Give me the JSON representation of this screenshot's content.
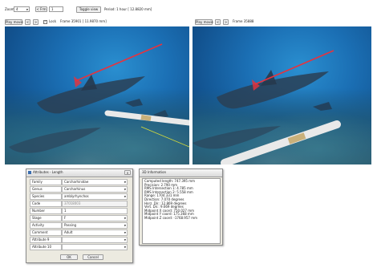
{
  "toolbar": {
    "zoom_label": "Zoom",
    "zoom_value": "4",
    "frame_step_label": "< Frm",
    "frame_step_value": "1",
    "toggle_button": "Toggle view",
    "period_text": "Period: 1 hour  [ 12.8820 mm]"
  },
  "left_pane": {
    "play_button": "Play movie",
    "nav_prev": "<",
    "nav_next": ">",
    "lock_label": "Lock",
    "frame_label": "Frame 35901  [ 11.9870 mm]"
  },
  "right_pane": {
    "play_button": "Play movie",
    "nav_prev": "<",
    "nav_next": ">",
    "frame_label": "Frame 35888"
  },
  "attributes_dialog": {
    "title": "Attributes - Length",
    "close": "×",
    "rows": [
      {
        "label": "Family",
        "value": "Carcharhinidae",
        "dropdown": true,
        "disabled": false
      },
      {
        "label": "Genus",
        "value": "Carcharhinus",
        "dropdown": true,
        "disabled": false
      },
      {
        "label": "Species",
        "value": "amblyrhynchos",
        "dropdown": true,
        "disabled": false
      },
      {
        "label": "Code",
        "value": "37018003",
        "dropdown": false,
        "disabled": true
      },
      {
        "label": "Number",
        "value": "1",
        "dropdown": false,
        "disabled": false
      },
      {
        "label": "Stage",
        "value": "F",
        "dropdown": true,
        "disabled": false
      },
      {
        "label": "Activity",
        "value": "Passing",
        "dropdown": true,
        "disabled": false
      },
      {
        "label": "Comment",
        "value": "Adult",
        "dropdown": true,
        "disabled": false
      },
      {
        "label": "Attribute 9",
        "value": "",
        "dropdown": true,
        "disabled": false
      },
      {
        "label": "Attribute 10",
        "value": "",
        "dropdown": true,
        "disabled": false
      }
    ],
    "ok": "OK",
    "cancel": "Cancel"
  },
  "info_dialog": {
    "title": "3D Information",
    "lines": [
      "Computed length: 747.395 mm",
      "Precision: 2.790 mm",
      "RMS Intersection 1: 4.785 mm",
      "RMS Intersection 2: 5.558 mm",
      "Range: 1704.331 mm",
      "Direction: 7.070 degrees",
      "Horz. Dir.: 12.869 degrees",
      "Vert. Dir.: 9.669 degrees",
      "Midpoint X coord: 750.027 mm",
      "Midpoint Y coord: 175.368 mm",
      "Midpoint Z coord: -1768.957 mm"
    ]
  },
  "colors": {
    "measure_line": "#e8323c",
    "ocean": "#1b6fb4"
  }
}
